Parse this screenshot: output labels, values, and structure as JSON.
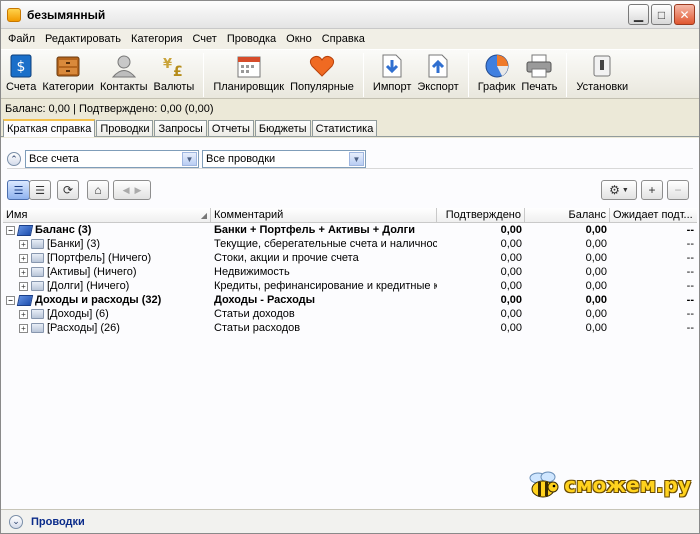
{
  "window": {
    "title": "безымянный"
  },
  "menu": [
    "Файл",
    "Редактировать",
    "Категория",
    "Счет",
    "Проводка",
    "Окно",
    "Справка"
  ],
  "toolbar": [
    {
      "label": "Счета",
      "icon": "accounts-icon"
    },
    {
      "label": "Категории",
      "icon": "categories-icon"
    },
    {
      "label": "Контакты",
      "icon": "contacts-icon"
    },
    {
      "label": "Валюты",
      "icon": "currencies-icon"
    },
    {
      "label": "Планировщик",
      "icon": "scheduler-icon"
    },
    {
      "label": "Популярные",
      "icon": "favorites-heart-icon"
    },
    {
      "label": "Импорт",
      "icon": "import-icon"
    },
    {
      "label": "Экспорт",
      "icon": "export-icon"
    },
    {
      "label": "График",
      "icon": "chart-icon"
    },
    {
      "label": "Печать",
      "icon": "printer-icon"
    },
    {
      "label": "Установки",
      "icon": "settings-switch-icon"
    }
  ],
  "balance_line": "Баланс: 0,00 | Подтверждено: 0,00 (0,00)",
  "tabs": [
    "Краткая справка",
    "Проводки",
    "Запросы",
    "Отчеты",
    "Бюджеты",
    "Статистика"
  ],
  "filters": {
    "accounts": "Все счета",
    "transactions": "Все проводки"
  },
  "table": {
    "columns": [
      "Имя",
      "Комментарий",
      "Подтверждено",
      "Баланс",
      "Ожидает подт..."
    ],
    "rows": [
      {
        "name": "Баланс (3)",
        "comment": "Банки + Портфель + Активы + Долги",
        "confirmed": "0,00",
        "balance": "0,00",
        "pending": "--",
        "group": true
      },
      {
        "name": "[Банки] (3)",
        "comment": "Текущие, сберегательные счета и наличность",
        "confirmed": "0,00",
        "balance": "0,00",
        "pending": "--",
        "group": false
      },
      {
        "name": "[Портфель] (Ничего)",
        "comment": "Стоки, акции и прочие счета",
        "confirmed": "0,00",
        "balance": "0,00",
        "pending": "--",
        "group": false
      },
      {
        "name": "[Активы] (Ничего)",
        "comment": "Недвижимость",
        "confirmed": "0,00",
        "balance": "0,00",
        "pending": "--",
        "group": false
      },
      {
        "name": "[Долги] (Ничего)",
        "comment": "Кредиты, рефинансирование и кредитные карты",
        "confirmed": "0,00",
        "balance": "0,00",
        "pending": "--",
        "group": false
      },
      {
        "name": "Доходы и расходы (32)",
        "comment": "Доходы - Расходы",
        "confirmed": "0,00",
        "balance": "0,00",
        "pending": "--",
        "group": true
      },
      {
        "name": "[Доходы] (6)",
        "comment": "Статьи доходов",
        "confirmed": "0,00",
        "balance": "0,00",
        "pending": "--",
        "group": false
      },
      {
        "name": "[Расходы] (26)",
        "comment": "Статьи расходов",
        "confirmed": "0,00",
        "balance": "0,00",
        "pending": "--",
        "group": false
      }
    ]
  },
  "bottom": {
    "link": "Проводки"
  },
  "watermark": "сможем.ру"
}
